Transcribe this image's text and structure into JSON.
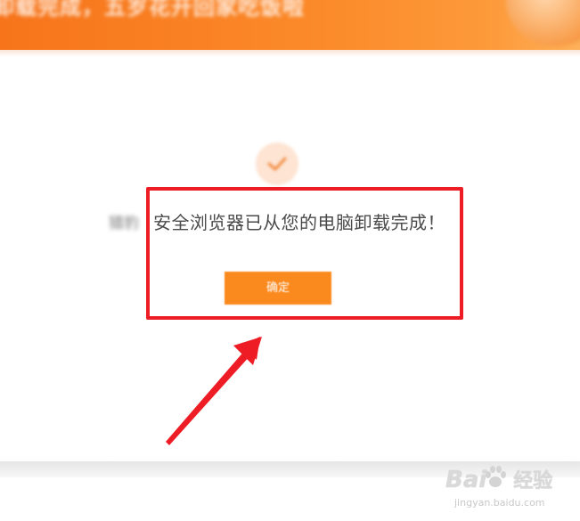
{
  "header": {
    "title": "卸载完成，五岁花开回家吃饭啦"
  },
  "content": {
    "blurred_prefix": "猎豹",
    "message": "安全浏览器已从您的电脑卸载完成！",
    "confirm_label": "确定"
  },
  "annotation": {
    "box_color": "#ee1c24",
    "arrow_color": "#ee1c24"
  },
  "watermark": {
    "logo": "Bai",
    "logo_suffix": "经验",
    "url": "jingyan.baidu.com"
  },
  "colors": {
    "accent": "#fb8a1e",
    "header": "#f7741a",
    "check_bg": "#fde4d3"
  }
}
